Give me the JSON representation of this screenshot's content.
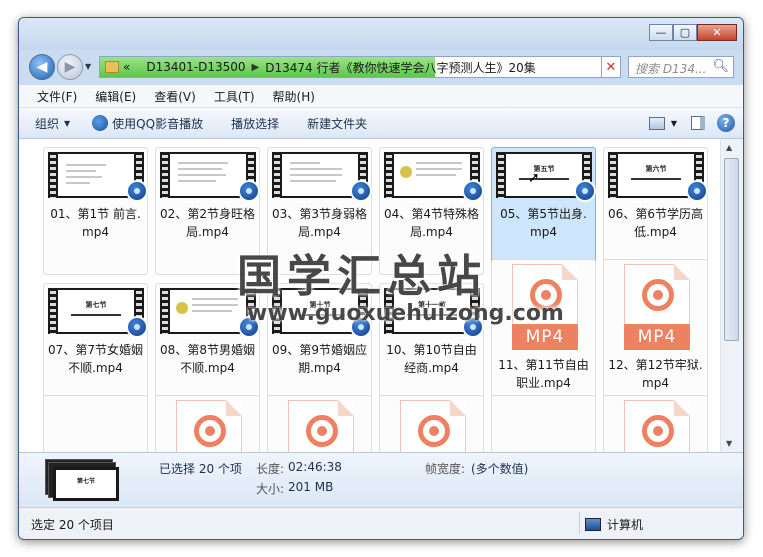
{
  "window": {
    "minimize": "—",
    "maximize": "▢",
    "close": "✕"
  },
  "address": {
    "prefix": "«",
    "crumb1": "D13401-D13500",
    "crumb2": "D13474 行者《教你快速学会八字预测人生》20集",
    "clear": "✕",
    "search_placeholder": "搜索 D134...",
    "progress_fill_color": "#5cc84a"
  },
  "menu": [
    "文件(F)",
    "编辑(E)",
    "查看(V)",
    "工具(T)",
    "帮助(H)"
  ],
  "toolbar": {
    "organize": "组织",
    "play_qq": "使用QQ影音播放",
    "play_selected": "播放选择",
    "new_folder": "新建文件夹",
    "help": "?"
  },
  "files": [
    {
      "line1": "01、第1节 前言.",
      "line2": "mp4",
      "kind": "video",
      "slide": ""
    },
    {
      "line1": "02、第2节身旺格",
      "line2": "局.mp4",
      "kind": "video",
      "slide": ""
    },
    {
      "line1": "03、第3节身弱格",
      "line2": "局.mp4",
      "kind": "video",
      "slide": ""
    },
    {
      "line1": "04、第4节特殊格",
      "line2": "局.mp4",
      "kind": "video",
      "slide": ""
    },
    {
      "line1": "05、第5节出身.",
      "line2": "mp4",
      "kind": "video",
      "slide": "第五节",
      "selected": true
    },
    {
      "line1": "06、第6节学历高",
      "line2": "低.mp4",
      "kind": "video",
      "slide": "第六节"
    },
    {
      "line1": "07、第7节女婚姻",
      "line2": "不顺.mp4",
      "kind": "video",
      "slide": "第七节"
    },
    {
      "line1": "08、第8节男婚姻",
      "line2": "不顺.mp4",
      "kind": "video",
      "slide": ""
    },
    {
      "line1": "09、第9节婚姻应",
      "line2": "期.mp4",
      "kind": "video",
      "slide": "第十节"
    },
    {
      "line1": "10、第10节自由",
      "line2": "经商.mp4",
      "kind": "video",
      "slide": "第十一节"
    },
    {
      "line1": "11、第11节自由",
      "line2": "职业.mp4",
      "kind": "mp4"
    },
    {
      "line1": "12、第12节牢狱.",
      "line2": "mp4",
      "kind": "mp4"
    }
  ],
  "mp4_label": "MP4",
  "watermark": {
    "main": "国学汇总站",
    "url": "www.guoxuehuizong.com"
  },
  "details": {
    "selected": "已选择 20 个项",
    "length_label": "长度:",
    "length_value": "02:46:38",
    "size_label": "大小:",
    "size_value": "201 MB",
    "framewidth_label": "帧宽度:",
    "framewidth_value": "(多个数值)",
    "thumb_slide": "第七节"
  },
  "status": {
    "left": "选定 20 个项目",
    "right": "计算机"
  }
}
